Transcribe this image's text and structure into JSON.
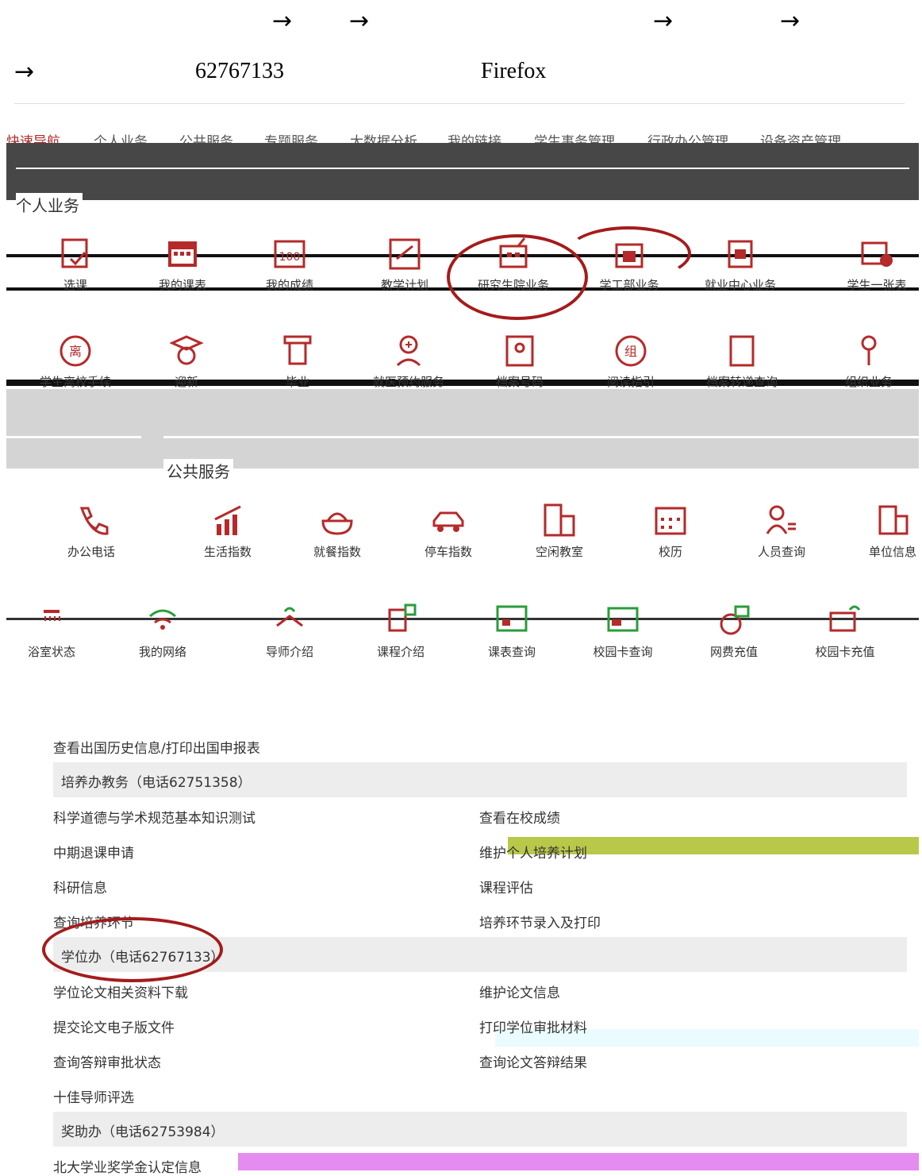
{
  "instructions": {
    "arrow": "→",
    "phone": "62767133",
    "browser": "Firefox"
  },
  "nav": {
    "items": [
      "快速导航",
      "个人业务",
      "公共服务",
      "专题服务",
      "大数据分析",
      "我的链接",
      "学生事务管理",
      "行政办公管理",
      "设备资产管理"
    ]
  },
  "personal": {
    "title": "个人业务",
    "row1": [
      "选课",
      "我的课表",
      "我的成绩",
      "教学计划",
      "研究生院业务",
      "学工部业务",
      "就业中心业务",
      "学生一张表"
    ],
    "row2": [
      "学生离校手续",
      "迎新",
      "毕业",
      "就医预约服务",
      "档案号码",
      "阅读指引",
      "档案转递查询",
      "组织业务"
    ]
  },
  "public": {
    "title": "公共服务",
    "row1": [
      "办公电话",
      "生活指数",
      "就餐指数",
      "停车指数",
      "空闲教室",
      "校历",
      "人员查询",
      "单位信息"
    ],
    "row2": [
      "浴室状态",
      "我的网络",
      "导师介绍",
      "课程介绍",
      "课表查询",
      "校园卡查询",
      "网费充值",
      "校园卡充值"
    ]
  },
  "grad_list": {
    "top_item": "查看出国历史信息/打印出国申报表",
    "groups": [
      {
        "title": "培养办教务（电话62751358）",
        "items": [
          [
            "科学道德与学术规范基本知识测试",
            "查看在校成绩"
          ],
          [
            "中期退课申请",
            "维护个人培养计划"
          ],
          [
            "科研信息",
            "课程评估"
          ],
          [
            "查询培养环节",
            "培养环节录入及打印"
          ]
        ]
      },
      {
        "title": "学位办（电话62767133）",
        "items": [
          [
            "学位论文相关资料下载",
            "维护论文信息"
          ],
          [
            "提交论文电子版文件",
            "打印学位审批材料"
          ],
          [
            "查询答辩审批状态",
            "查询论文答辩结果"
          ],
          [
            "十佳导师评选",
            ""
          ]
        ]
      },
      {
        "title": "奖助办（电话62753984）",
        "items": [
          [
            "北大学业奖学金认定信息",
            ""
          ]
        ]
      }
    ]
  },
  "colors": {
    "accent": "#b52a2a",
    "band": "#474747",
    "oval": "#a51b1b"
  }
}
